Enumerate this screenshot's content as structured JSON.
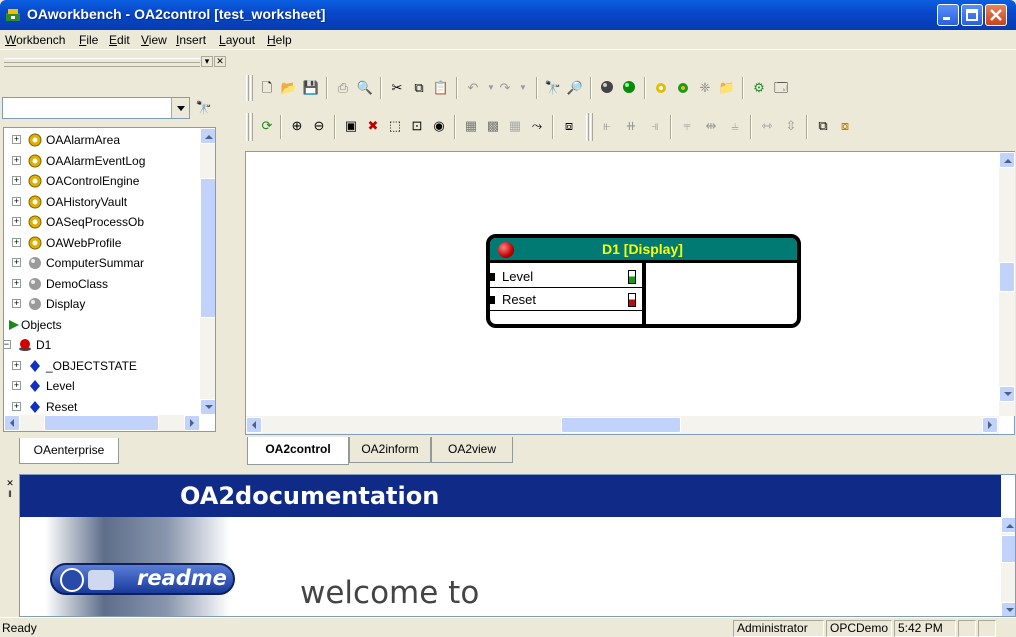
{
  "window": {
    "title": "OAworkbench - OA2control [test_worksheet]"
  },
  "menu": [
    "Workbench",
    "File",
    "Edit",
    "View",
    "Insert",
    "Layout",
    "Help"
  ],
  "left_panel": {
    "search_value": "",
    "tree": [
      {
        "label": "OAAlarmArea",
        "icon": "class-icon"
      },
      {
        "label": "OAAlarmEventLog",
        "icon": "class-icon"
      },
      {
        "label": "OAControlEngine",
        "icon": "class-icon"
      },
      {
        "label": "OAHistoryVault",
        "icon": "class-icon"
      },
      {
        "label": "OASeqProcessOb",
        "icon": "class-icon"
      },
      {
        "label": "OAWebProfile",
        "icon": "class-icon"
      },
      {
        "label": "ComputerSummar",
        "icon": "sphere-icon"
      },
      {
        "label": "DemoClass",
        "icon": "sphere-icon"
      },
      {
        "label": "Display",
        "icon": "sphere-icon"
      },
      {
        "label": "Objects",
        "icon": "objects-icon"
      },
      {
        "label": "D1",
        "icon": "alarm-icon"
      },
      {
        "label": "_OBJECTSTATE",
        "icon": "diamond-icon"
      },
      {
        "label": "Level",
        "icon": "diamond-icon"
      },
      {
        "label": "Reset",
        "icon": "diamond-icon"
      }
    ],
    "tab": "OAenterprise"
  },
  "canvas": {
    "object": {
      "title": "D1 [Display]",
      "ports": [
        {
          "label": "Level",
          "led_color": "#1A9A1A"
        },
        {
          "label": "Reset",
          "led_color": "#B01010"
        }
      ]
    }
  },
  "editor_tabs": [
    {
      "label": "OA2control",
      "active": true
    },
    {
      "label": "OA2inform",
      "active": false
    },
    {
      "label": "OA2view",
      "active": false
    }
  ],
  "doc": {
    "heading": "OA2documentation",
    "readme": "readme",
    "welcome": "welcome to"
  },
  "status": {
    "text": "Ready",
    "user": "Administrator",
    "project": "OPCDemo",
    "time": "5:42 PM"
  },
  "colors": {
    "title_bar": "#0846C8",
    "object_header": "#007A72",
    "object_title": "#FFFF00",
    "doc_banner": "#102A88"
  }
}
